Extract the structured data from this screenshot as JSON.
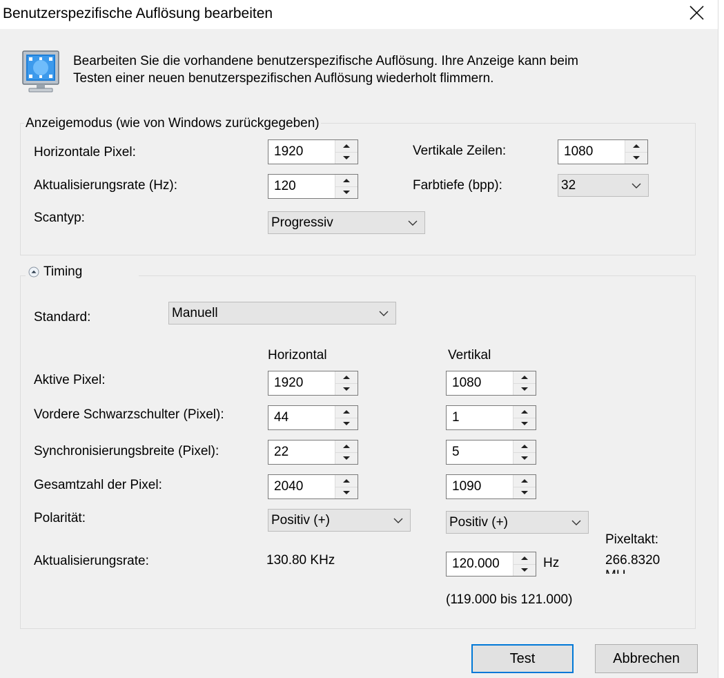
{
  "window": {
    "title": "Benutzerspezifische Auflösung bearbeiten"
  },
  "description": {
    "line1": "Bearbeiten Sie die vorhandene benutzerspezifische Auflösung. Ihre Anzeige kann beim",
    "line2": "Testen einer neuen benutzerspezifischen Auflösung wiederholt flimmern."
  },
  "display_mode": {
    "legend": "Anzeigemodus (wie von Windows zurückgegeben)",
    "horizontal_pixels": {
      "label": "Horizontale Pixel:",
      "value": "1920"
    },
    "vertical_lines": {
      "label": "Vertikale Zeilen:",
      "value": "1080"
    },
    "refresh_rate": {
      "label": "Aktualisierungsrate (Hz):",
      "value": "120"
    },
    "color_depth": {
      "label": "Farbtiefe (bpp):",
      "value": "32"
    },
    "scan_type": {
      "label": "Scantyp:",
      "value": "Progressiv"
    }
  },
  "timing": {
    "legend": "Timing",
    "standard": {
      "label": "Standard:",
      "value": "Manuell"
    },
    "col_horizontal": "Horizontal",
    "col_vertical": "Vertikal",
    "active_pixels": {
      "label": "Aktive Pixel:",
      "h": "1920",
      "v": "1080"
    },
    "front_porch": {
      "label": "Vordere Schwarzschulter (Pixel):",
      "h": "44",
      "v": "1"
    },
    "sync_width": {
      "label": "Synchronisierungsbreite (Pixel):",
      "h": "22",
      "v": "5"
    },
    "total_pixels": {
      "label": "Gesamtzahl der Pixel:",
      "h": "2040",
      "v": "1090"
    },
    "polarity": {
      "label": "Polarität:",
      "h": "Positiv (+)",
      "v": "Positiv (+)"
    },
    "refresh": {
      "label": "Aktualisierungsrate:",
      "h": "130.80 KHz",
      "v": "120.000",
      "unit": "Hz",
      "range": "(119.000 bis 121.000)"
    },
    "pixel_clock": {
      "label": "Pixeltakt:",
      "value": "266.8320",
      "unit_partial": "MH"
    }
  },
  "buttons": {
    "test": "Test",
    "cancel": "Abbrechen"
  },
  "colors": {
    "accent": "#0078d7",
    "background": "#f0f0f0"
  }
}
